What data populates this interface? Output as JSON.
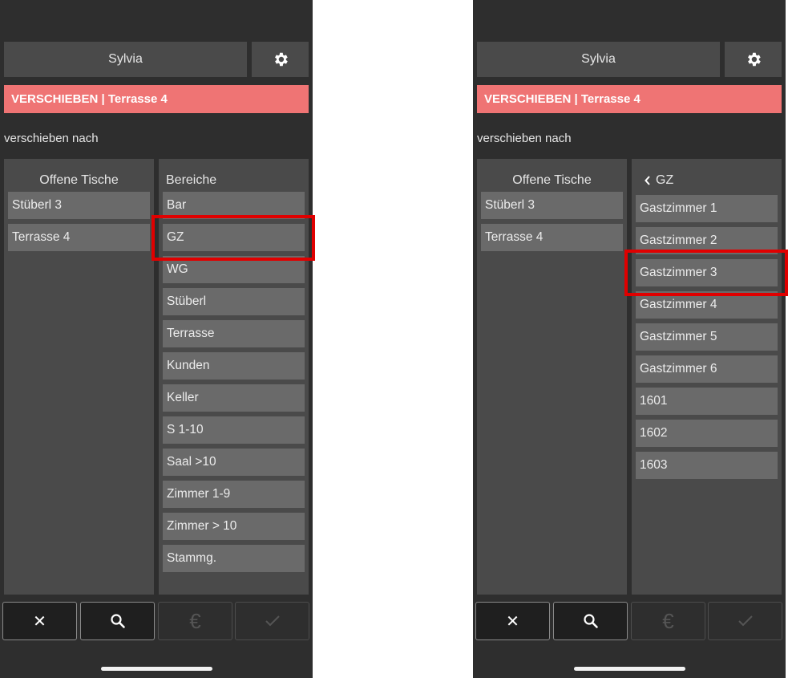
{
  "left": {
    "user": "Sylvia",
    "banner": "VERSCHIEBEN | Terrasse 4",
    "subtitle": "verschieben nach",
    "open_tables_title": "Offene Tische",
    "open_tables": [
      "Stüberl 3",
      "Terrasse 4"
    ],
    "areas_title": "Bereiche",
    "areas": [
      "Bar",
      "GZ",
      "WG",
      "Stüberl",
      "Terrasse",
      "Kunden",
      "Keller",
      "S 1-10",
      "Saal >10",
      "Zimmer 1-9",
      "Zimmer > 10",
      "Stammg."
    ],
    "highlighted": "GZ"
  },
  "right": {
    "user": "Sylvia",
    "banner": "VERSCHIEBEN | Terrasse 4",
    "subtitle": "verschieben nach",
    "open_tables_title": "Offene Tische",
    "open_tables": [
      "Stüberl 3",
      "Terrasse 4"
    ],
    "back_title": "GZ",
    "rooms": [
      "Gastzimmer 1",
      "Gastzimmer 2",
      "Gastzimmer 3",
      "Gastzimmer 4",
      "Gastzimmer 5",
      "Gastzimmer 6",
      "1601",
      "1602",
      "1603"
    ],
    "highlighted": "Gastzimmer 3"
  },
  "toolbar": {
    "icons": [
      "close-icon",
      "search-icon",
      "euro-icon",
      "check-icon"
    ],
    "close_glyph": "✕",
    "euro_glyph": "€"
  },
  "colors": {
    "background": "#2e2e2e",
    "panel": "#4a4a4a",
    "item": "#6a6a6a",
    "banner": "#ef7474",
    "highlight": "#e00000"
  }
}
